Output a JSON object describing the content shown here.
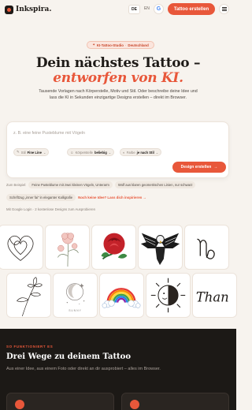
{
  "brand": {
    "name": "Inkspira."
  },
  "header": {
    "lang_de": "DE",
    "lang_en": "EN",
    "google_glyph": "G",
    "cta": "Tattoo erstellen"
  },
  "hero": {
    "badge_prefix": "✦",
    "badge_label": "KI-Tattoo-Studio",
    "badge_sep": "·",
    "badge_country": "Deutschland",
    "title_line1": "Dein nächstes Tattoo –",
    "title_line2": "entworfen von KI.",
    "subtitle": "Tausende Vorlagen nach Körperstelle, Motiv und Stil. Oder beschreibe deine Idee und lass die KI in Sekunden einzigartige Designs erstellen – direkt im Browser."
  },
  "generator": {
    "placeholder": "z. B. eine feine Pusteblume mit Vögeln",
    "style_label": "Stil",
    "style_value": "Fine Line",
    "body_label": "Körperstelle",
    "body_value": "beliebig",
    "color_label": "Farbe",
    "color_value": "je nach Stil",
    "button_label": "Design erstellen",
    "button_arrow": "→"
  },
  "examples": {
    "label": "Zum Beispiel:",
    "items": [
      "Feine Pusteblume mit zwei kleinen Vögeln, Unterarm",
      "Wolf aus klaren geometrischen Linien, nur schwarz",
      "Schriftzug „inner fai“ in eleganter Kalligrafie"
    ],
    "inspire_link": "Noch keine Idee? Lass dich inspirieren →"
  },
  "social_proof": "Mit Google Login · 2 kostenlose Designs zum Ausprobieren",
  "gallery": {
    "items": [
      {
        "name": "hearts-lineart"
      },
      {
        "name": "peony-floral"
      },
      {
        "name": "red-rose"
      },
      {
        "name": "eagle-blackwork"
      },
      {
        "name": "capricorn-symbol"
      },
      {
        "name": "line-flower"
      },
      {
        "name": "moon-stars"
      },
      {
        "name": "rainbow-clouds"
      },
      {
        "name": "sun-moon"
      },
      {
        "name": "script-lettering"
      }
    ],
    "moon_caption": "SUNNY",
    "script_text": "Than"
  },
  "how_it_works": {
    "kicker": "SO FUNKTIONIERT ES",
    "title": "Drei Wege zu deinem Tattoo",
    "text": "Aus einer Idee, aus einem Foto oder direkt an dir ausprobiert – alles im Browser."
  },
  "colors": {
    "accent": "#e8573a",
    "background": "#f7f3ee",
    "dark": "#1c1916"
  }
}
